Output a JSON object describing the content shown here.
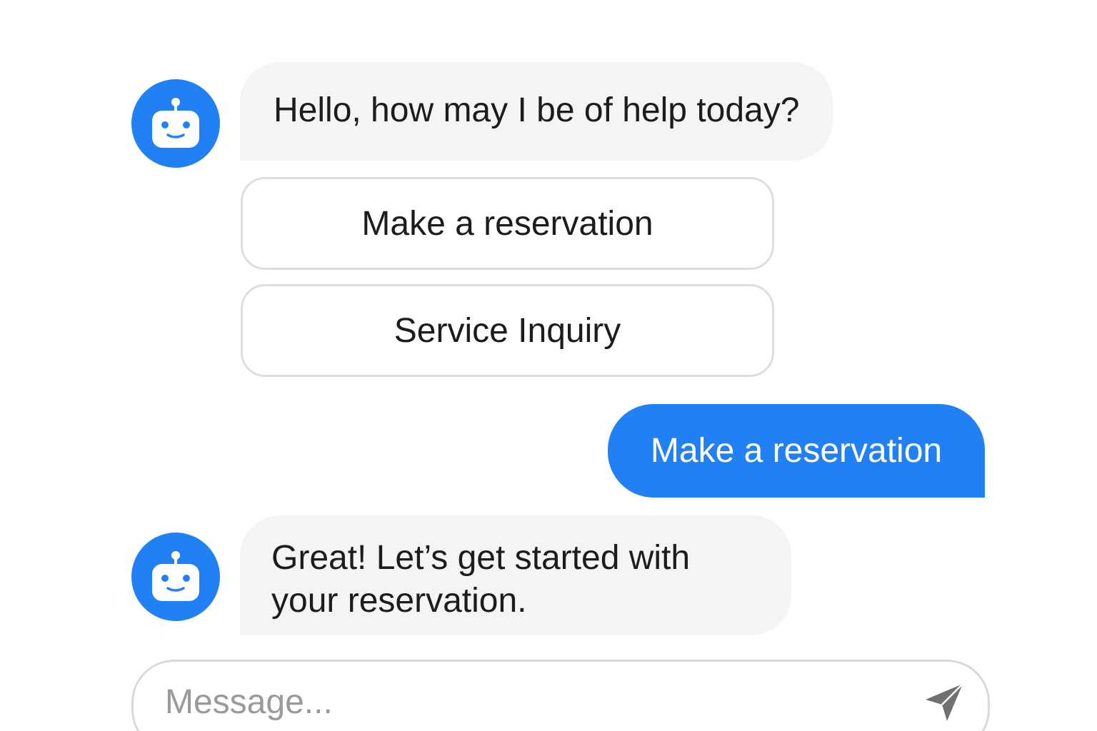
{
  "conversation": {
    "bot_message_1": "Hello, how may I be of help today?",
    "quick_replies": [
      {
        "label": "Make a reservation"
      },
      {
        "label": "Service Inquiry"
      }
    ],
    "user_message_1": "Make a reservation",
    "bot_message_2": "Great! Let’s get started with your reservation."
  },
  "composer": {
    "placeholder": "Message...",
    "value": ""
  },
  "icons": {
    "bot_avatar": "robot-icon",
    "send": "paper-plane-send-icon"
  },
  "colors": {
    "accent": "#2280f5",
    "bot_bubble": "#f4f4f4",
    "quick_reply_border": "#dedede",
    "placeholder": "#9a9a9a",
    "send_icon": "#707070"
  }
}
